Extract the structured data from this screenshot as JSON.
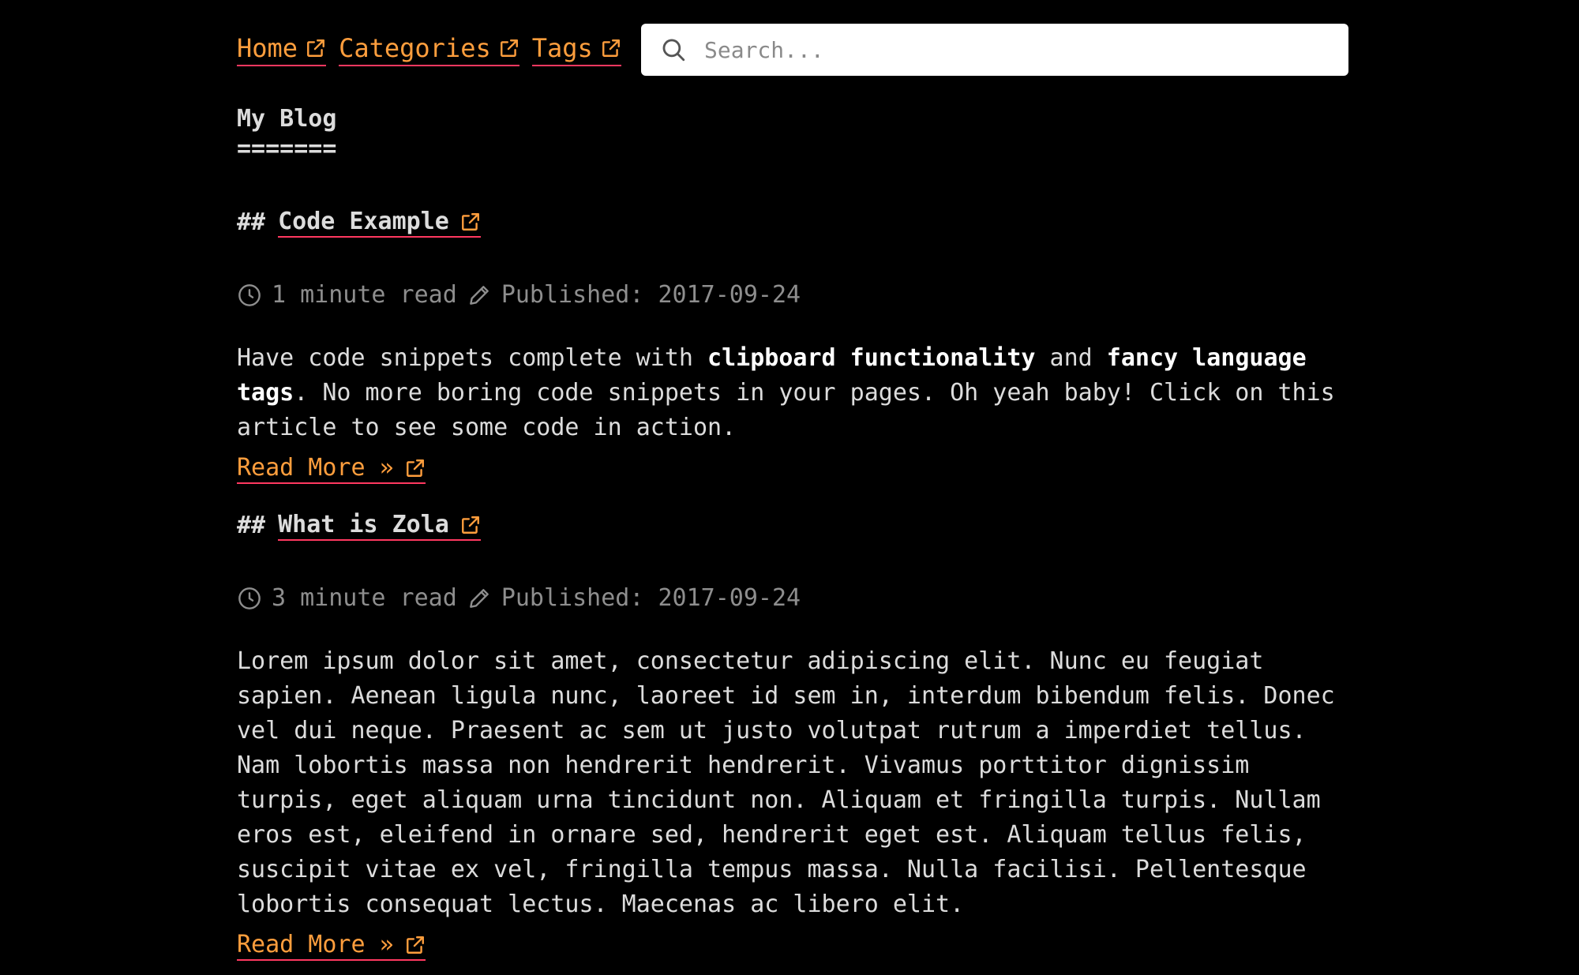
{
  "nav": {
    "items": [
      {
        "label": "Home",
        "icon": "external-link-icon"
      },
      {
        "label": "Categories",
        "icon": "external-link-icon"
      },
      {
        "label": "Tags",
        "icon": "external-link-icon"
      }
    ]
  },
  "search": {
    "placeholder": "Search...",
    "icon": "search-icon"
  },
  "blog": {
    "title": "My Blog",
    "underline": "======="
  },
  "posts": [
    {
      "prefix": "##",
      "title": "Code Example",
      "read_time": "1 minute read",
      "published": "Published: 2017-09-24",
      "summary_parts": [
        "Have code snippets complete with ",
        "clipboard functionality",
        " and ",
        "fancy language tags",
        ". No more boring code snippets in your pages. Oh yeah baby! Click on this article to see some code in action."
      ],
      "read_more": "Read More »"
    },
    {
      "prefix": "##",
      "title": "What is Zola",
      "read_time": "3 minute read",
      "published": "Published: 2017-09-24",
      "summary": "Lorem ipsum dolor sit amet, consectetur adipiscing elit. Nunc eu feugiat sapien. Aenean ligula nunc, laoreet id sem in, interdum bibendum felis. Donec vel dui neque. Praesent ac sem ut justo volutpat rutrum a imperdiet tellus. Nam lobortis massa non hendrerit hendrerit. Vivamus porttitor dignissim turpis, eget aliquam urna tincidunt non. Aliquam et fringilla turpis. Nullam eros est, eleifend in ornare sed, hendrerit eget est. Aliquam tellus felis, suscipit vitae ex vel, fringilla tempus massa. Nulla facilisi. Pellentesque lobortis consequat lectus. Maecenas ac libero elit.",
      "read_more": "Read More »"
    }
  ],
  "colors": {
    "background": "#000000",
    "link": "#ff9e3d",
    "underline": "#ff3860",
    "text": "#dcdcdc",
    "muted": "#8e8e8e"
  }
}
